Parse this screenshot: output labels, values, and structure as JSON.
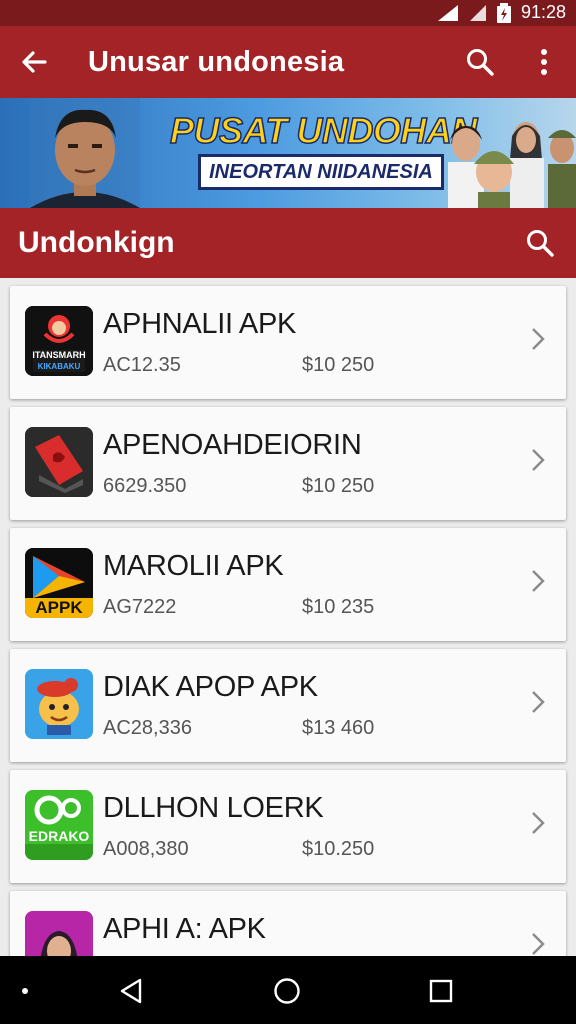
{
  "status_bar": {
    "time": "91:28",
    "icons": [
      "signal-icon",
      "wifi-icon",
      "battery-icon"
    ]
  },
  "app_bar": {
    "title": "Unusar undonesia",
    "icons": [
      "back-arrow-icon",
      "search-icon",
      "more-vert-icon"
    ]
  },
  "banner": {
    "headline": "PUSAT UNDOHAN",
    "subtitle": "INEORTAN NIIDANESIA"
  },
  "section": {
    "title": "Undonkign",
    "icons": [
      "search-icon"
    ]
  },
  "apps": [
    {
      "name": "APHNALII APK",
      "code": "AC12.35",
      "price": "$10 250",
      "icon_text_top": "ITANSMARH",
      "icon_text_bottom": "KIKABAKU"
    },
    {
      "name": "APENOAHDEIORIN",
      "code": "6629.350",
      "price": "$10 250"
    },
    {
      "name": "MAROLII APK",
      "code": "AG7222",
      "price": "$10 235",
      "icon_text": "APPK"
    },
    {
      "name": "DIAK APOP APK",
      "code": "AC28,336",
      "price": "$13 460"
    },
    {
      "name": "DLLHON LOERK",
      "code": "A008,380",
      "price": "$10.250",
      "icon_text": "EDRAKO"
    },
    {
      "name": "APHI A: APK",
      "code": "",
      "price": ""
    }
  ],
  "colors": {
    "primary": "#a32326",
    "status_bar": "#7a1a1c",
    "background": "#ececec"
  },
  "nav_bar": {
    "icons": [
      "back-triangle-icon",
      "home-circle-icon",
      "recents-square-icon"
    ]
  }
}
